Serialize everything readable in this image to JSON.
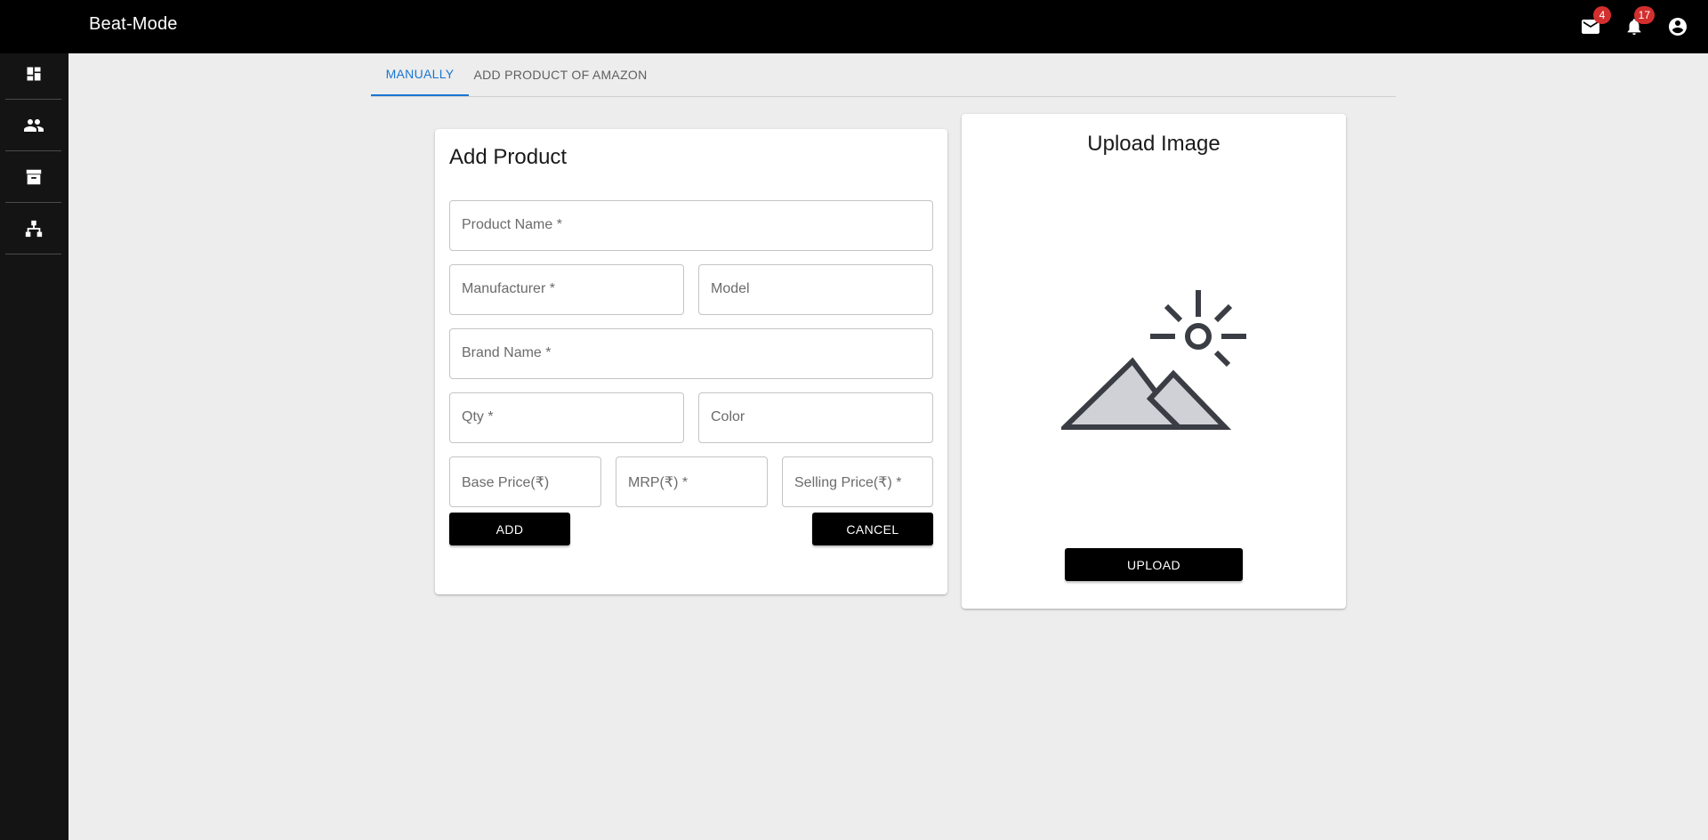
{
  "app": {
    "title": "Beat-Mode"
  },
  "header": {
    "mail_badge": "4",
    "notifications_badge": "17"
  },
  "tabs": [
    {
      "label": "MANUALLY",
      "active": true
    },
    {
      "label": "ADD PRODUCT OF AMAZON",
      "active": false
    }
  ],
  "form": {
    "title": "Add Product",
    "fields": {
      "product_name": "Product Name *",
      "manufacturer": "Manufacturer *",
      "model": "Model",
      "brand_name": "Brand Name *",
      "qty": "Qty *",
      "color": "Color",
      "base_price": "Base Price(₹)",
      "mrp": "MRP(₹) *",
      "selling_price": "Selling Price(₹) *"
    },
    "add_label": "ADD",
    "cancel_label": "CANCEL"
  },
  "upload": {
    "title": "Upload Image",
    "button_label": "UPLOAD"
  },
  "icons": {
    "sidebar": [
      "menu-icon",
      "dashboard-icon",
      "people-icon",
      "archive-icon",
      "sitemap-icon"
    ],
    "header": [
      "mail-icon",
      "bell-icon",
      "account-circle-icon"
    ],
    "upload": "image-placeholder-icon"
  },
  "colors": {
    "accent": "#1976d2",
    "topbar": "#000000",
    "sidebar": "#141414",
    "badge": "#d32f2f",
    "background": "#ededed"
  }
}
